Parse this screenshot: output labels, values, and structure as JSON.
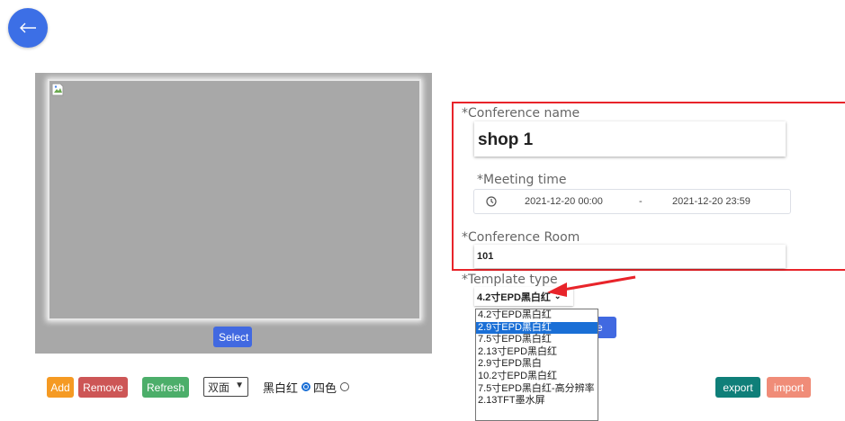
{
  "header": {
    "back_icon": "arrow-left-icon",
    "back_color": "#3c6fe6"
  },
  "preview": {
    "select_label": "Select"
  },
  "toolbar": {
    "add_label": "Add",
    "remove_label": "Remove",
    "refresh_label": "Refresh",
    "side_value": "双面",
    "color_option_1": "黑白红",
    "color_option_2": "四色",
    "color_option_1_checked": true,
    "export_label": "export",
    "import_label": "import"
  },
  "form": {
    "conference_name_label": "*Conference name",
    "conference_name_value": "shop 1",
    "meeting_time_label": "*Meeting time",
    "meeting_start": "2021-12-20 00:00",
    "meeting_separator": "-",
    "meeting_end": "2021-12-20 23:59",
    "conference_room_label": "*Conference Room",
    "conference_room_value": "101",
    "template_type_label": "*Template type",
    "template_type_value": "4.2寸EPD黑白红",
    "save_label": "ve"
  },
  "template_options": [
    "4.2寸EPD黑白红",
    "2.9寸EPD黑白红",
    "7.5寸EPD黑白红",
    "2.13寸EPD黑白红",
    "2.9寸EPD黑白",
    "10.2寸EPD黑白红",
    "7.5寸EPD黑白红-高分辨率",
    "2.13TFT墨水屏"
  ],
  "template_selected_index": 1,
  "colors": {
    "accent": "#4169e1",
    "highlight": "#e8242a",
    "add": "#f59a23",
    "remove": "#cd5656",
    "refresh": "#4cae6a",
    "export": "#0f7f79",
    "import": "#f08c78"
  }
}
